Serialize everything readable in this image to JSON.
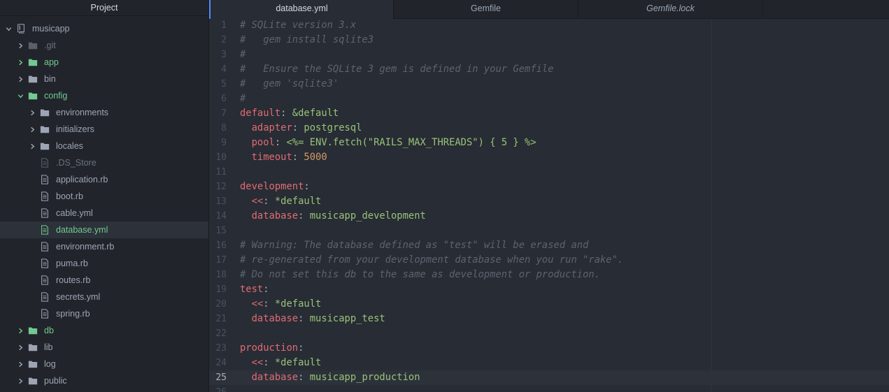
{
  "sidebar": {
    "title": "Project",
    "tree": [
      {
        "label": "musicapp",
        "kind": "repo",
        "indent": 0,
        "state": "open",
        "tone": "normal"
      },
      {
        "label": ".git",
        "kind": "folder",
        "indent": 1,
        "state": "closed",
        "tone": "dim"
      },
      {
        "label": "app",
        "kind": "folder",
        "indent": 1,
        "state": "closed",
        "tone": "green"
      },
      {
        "label": "bin",
        "kind": "folder",
        "indent": 1,
        "state": "closed",
        "tone": "normal"
      },
      {
        "label": "config",
        "kind": "folder",
        "indent": 1,
        "state": "open",
        "tone": "green"
      },
      {
        "label": "environments",
        "kind": "folder",
        "indent": 2,
        "state": "closed",
        "tone": "normal"
      },
      {
        "label": "initializers",
        "kind": "folder",
        "indent": 2,
        "state": "closed",
        "tone": "normal"
      },
      {
        "label": "locales",
        "kind": "folder",
        "indent": 2,
        "state": "closed",
        "tone": "normal"
      },
      {
        "label": ".DS_Store",
        "kind": "file",
        "indent": 2,
        "state": "none",
        "tone": "dim"
      },
      {
        "label": "application.rb",
        "kind": "file",
        "indent": 2,
        "state": "none",
        "tone": "normal"
      },
      {
        "label": "boot.rb",
        "kind": "file",
        "indent": 2,
        "state": "none",
        "tone": "normal"
      },
      {
        "label": "cable.yml",
        "kind": "file",
        "indent": 2,
        "state": "none",
        "tone": "normal"
      },
      {
        "label": "database.yml",
        "kind": "file",
        "indent": 2,
        "state": "none",
        "tone": "green",
        "selected": true
      },
      {
        "label": "environment.rb",
        "kind": "file",
        "indent": 2,
        "state": "none",
        "tone": "normal"
      },
      {
        "label": "puma.rb",
        "kind": "file",
        "indent": 2,
        "state": "none",
        "tone": "normal"
      },
      {
        "label": "routes.rb",
        "kind": "file",
        "indent": 2,
        "state": "none",
        "tone": "normal"
      },
      {
        "label": "secrets.yml",
        "kind": "file",
        "indent": 2,
        "state": "none",
        "tone": "normal"
      },
      {
        "label": "spring.rb",
        "kind": "file",
        "indent": 2,
        "state": "none",
        "tone": "normal"
      },
      {
        "label": "db",
        "kind": "folder",
        "indent": 1,
        "state": "closed",
        "tone": "green"
      },
      {
        "label": "lib",
        "kind": "folder",
        "indent": 1,
        "state": "closed",
        "tone": "normal"
      },
      {
        "label": "log",
        "kind": "folder",
        "indent": 1,
        "state": "closed",
        "tone": "normal"
      },
      {
        "label": "public",
        "kind": "folder",
        "indent": 1,
        "state": "closed",
        "tone": "normal"
      }
    ]
  },
  "tabs": [
    {
      "label": "database.yml",
      "active": true,
      "italic": false
    },
    {
      "label": "Gemfile",
      "active": false,
      "italic": false
    },
    {
      "label": "Gemfile.lock",
      "active": false,
      "italic": true
    }
  ],
  "editor": {
    "cursor_line": 25,
    "lines": [
      [
        [
          "c",
          "# SQLite version 3.x"
        ]
      ],
      [
        [
          "c",
          "#   gem install sqlite3"
        ]
      ],
      [
        [
          "c",
          "#"
        ]
      ],
      [
        [
          "c",
          "#   Ensure the SQLite 3 gem is defined in your Gemfile"
        ]
      ],
      [
        [
          "c",
          "#   gem 'sqlite3'"
        ]
      ],
      [
        [
          "c",
          "#"
        ]
      ],
      [
        [
          "k",
          "default"
        ],
        [
          "p",
          ": "
        ],
        [
          "s",
          "&default"
        ]
      ],
      [
        [
          "p",
          "  "
        ],
        [
          "k",
          "adapter"
        ],
        [
          "p",
          ": "
        ],
        [
          "s",
          "postgresql"
        ]
      ],
      [
        [
          "p",
          "  "
        ],
        [
          "k",
          "pool"
        ],
        [
          "p",
          ": "
        ],
        [
          "s",
          "<%= ENV.fetch(\"RAILS_MAX_THREADS\") { 5 } %>"
        ]
      ],
      [
        [
          "p",
          "  "
        ],
        [
          "k",
          "timeout"
        ],
        [
          "p",
          ": "
        ],
        [
          "n",
          "5000"
        ]
      ],
      [],
      [
        [
          "k",
          "development"
        ],
        [
          "p",
          ":"
        ]
      ],
      [
        [
          "p",
          "  "
        ],
        [
          "k",
          "<<"
        ],
        [
          "p",
          ": "
        ],
        [
          "s",
          "*default"
        ]
      ],
      [
        [
          "p",
          "  "
        ],
        [
          "k",
          "database"
        ],
        [
          "p",
          ": "
        ],
        [
          "s",
          "musicapp_development"
        ]
      ],
      [],
      [
        [
          "c",
          "# Warning: The database defined as \"test\" will be erased and"
        ]
      ],
      [
        [
          "c",
          "# re-generated from your development database when you run \"rake\"."
        ]
      ],
      [
        [
          "c",
          "# Do not set this db to the same as development or production."
        ]
      ],
      [
        [
          "k",
          "test"
        ],
        [
          "p",
          ":"
        ]
      ],
      [
        [
          "p",
          "  "
        ],
        [
          "k",
          "<<"
        ],
        [
          "p",
          ": "
        ],
        [
          "s",
          "*default"
        ]
      ],
      [
        [
          "p",
          "  "
        ],
        [
          "k",
          "database"
        ],
        [
          "p",
          ": "
        ],
        [
          "s",
          "musicapp_test"
        ]
      ],
      [],
      [
        [
          "k",
          "production"
        ],
        [
          "p",
          ":"
        ]
      ],
      [
        [
          "p",
          "  "
        ],
        [
          "k",
          "<<"
        ],
        [
          "p",
          ": "
        ],
        [
          "s",
          "*default"
        ]
      ],
      [
        [
          "p",
          "  "
        ],
        [
          "k",
          "database"
        ],
        [
          "p",
          ": "
        ],
        [
          "s",
          "musicapp_production"
        ]
      ],
      []
    ]
  },
  "colors": {
    "accent": "#528bff",
    "git_added": "#73c990",
    "yaml_key": "#e06c75",
    "yaml_string": "#98c379",
    "yaml_number": "#d19a66",
    "comment": "#5c6370"
  }
}
